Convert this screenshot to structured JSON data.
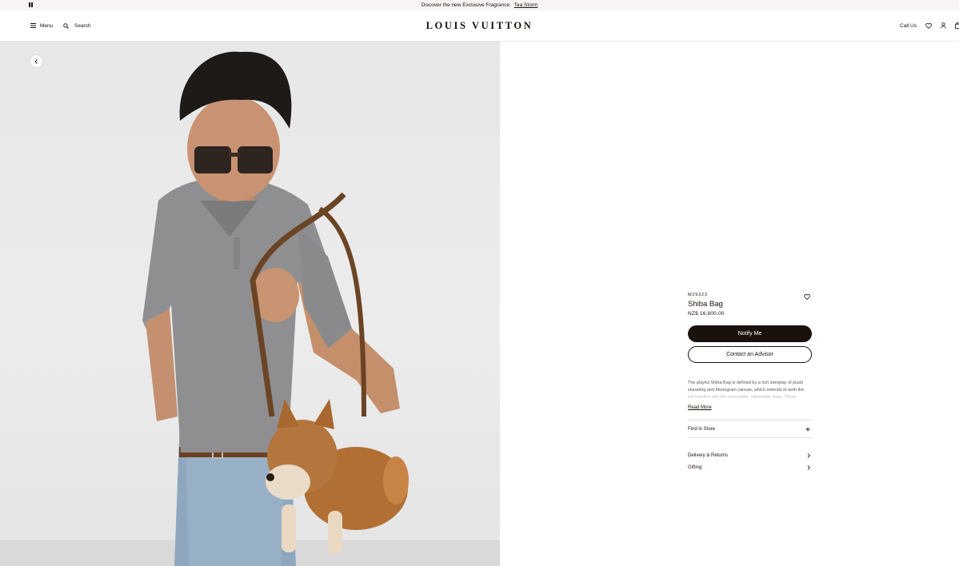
{
  "announcement": {
    "text": "Discover the new Exclusive Fragrance:",
    "link": "Tea Storm"
  },
  "header": {
    "menu_label": "Menu",
    "search_label": "Search",
    "logo": "LOUIS VUITTON",
    "call_us": "Call Us"
  },
  "product": {
    "sku": "M29323",
    "name": "Shiba Bag",
    "price": "NZ$ 16,800.00",
    "notify_label": "Notify Me",
    "contact_label": "Contact an Advisor",
    "description": "The playful Shiba Bag is defined by a rich interplay of plush shearling and Monogram canvas, which extends to both the top handles and the removable, adjustable strap. These",
    "read_more": "Read More",
    "find_in_store": "Find in Store",
    "delivery_returns": "Delivery & Returns",
    "gifting": "Gifting"
  },
  "colors": {
    "brand_dark": "#19110b",
    "announcement_bg": "#f6f5f3",
    "gallery_bg": "#e9e9e9"
  },
  "icons": [
    "pause-icon",
    "menu-icon",
    "search-icon",
    "wishlist-icon",
    "account-icon",
    "bag-icon",
    "chevron-left-icon",
    "heart-icon",
    "plus-icon",
    "chevron-right-icon"
  ]
}
